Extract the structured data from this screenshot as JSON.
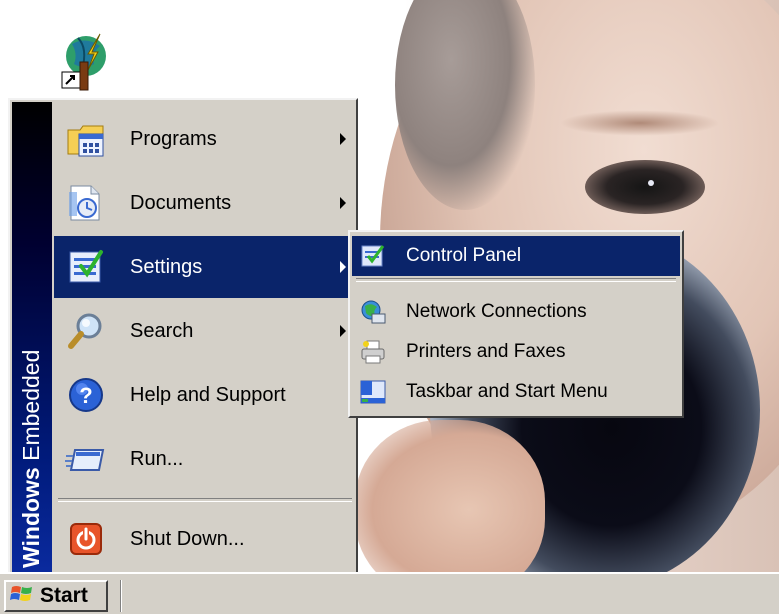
{
  "desktop": {
    "shortcut_icon": "globe-lightning-shortcut-icon"
  },
  "start_menu": {
    "banner": {
      "bold": "Windows",
      "rest": " Embedded"
    },
    "items": [
      {
        "label": "Programs",
        "icon": "programs-icon",
        "has_submenu": true
      },
      {
        "label": "Documents",
        "icon": "documents-icon",
        "has_submenu": true
      },
      {
        "label": "Settings",
        "icon": "settings-icon",
        "has_submenu": true,
        "active": true
      },
      {
        "label": "Search",
        "icon": "search-icon",
        "has_submenu": true
      },
      {
        "label": "Help and Support",
        "icon": "help-icon",
        "has_submenu": false
      },
      {
        "label": "Run...",
        "icon": "run-icon",
        "has_submenu": false
      },
      {
        "label": "Shut Down...",
        "icon": "shutdown-icon",
        "has_submenu": false
      }
    ]
  },
  "settings_submenu": {
    "items": [
      {
        "label": "Control Panel",
        "icon": "control-panel-icon",
        "active": true
      },
      {
        "label": "Network Connections",
        "icon": "network-connections-icon"
      },
      {
        "label": "Printers and Faxes",
        "icon": "printer-icon"
      },
      {
        "label": "Taskbar and Start Menu",
        "icon": "taskbar-icon"
      }
    ]
  },
  "taskbar": {
    "start_label": "Start"
  },
  "colors": {
    "menu_face": "#d4d0c8",
    "highlight": "#0a246a",
    "banner_bottom": "#0a2a9e"
  }
}
